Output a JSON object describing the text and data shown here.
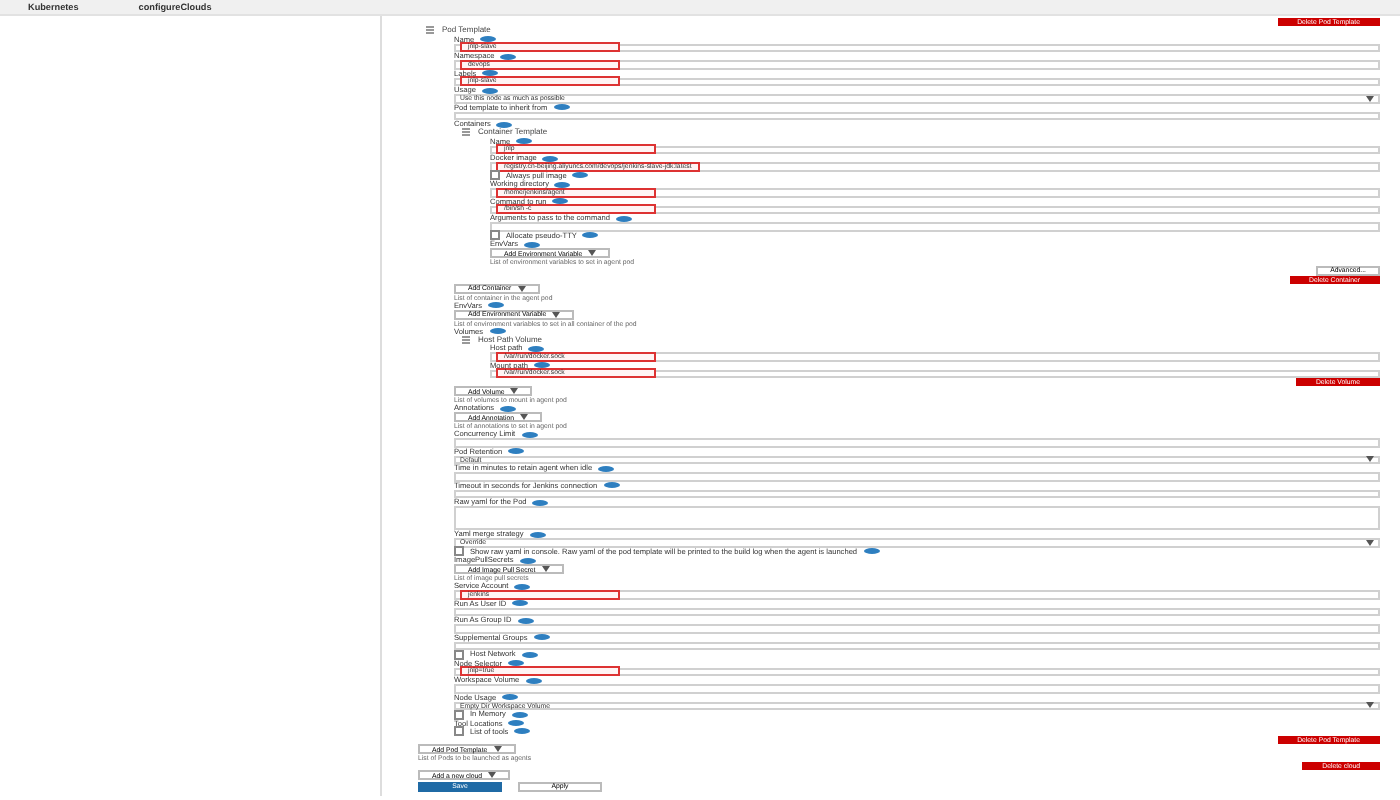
{
  "topbar": {
    "brand": "Kubernetes",
    "crumb": "configureClouds"
  },
  "items": [
    {
      "kind": "delete",
      "label": "Delete Pod Template"
    },
    {
      "kind": "section",
      "title": "Pod Template",
      "children": [
        {
          "kind": "field",
          "label": "Name",
          "value": "jnlp-slave",
          "highlighted": true
        },
        {
          "kind": "field",
          "label": "Namespace",
          "value": "devops",
          "highlighted": true
        },
        {
          "kind": "field",
          "label": "Labels",
          "value": "jnlp-slave",
          "highlighted": true
        },
        {
          "kind": "select",
          "label": "Usage",
          "value": "Use this node as much as possible",
          "highlighted": false
        },
        {
          "kind": "field",
          "label": "Pod template to inherit from",
          "highlighted": false
        },
        {
          "kind": "label",
          "label": "Containers"
        },
        {
          "kind": "section",
          "title": "Container Template",
          "children": [
            {
              "kind": "field",
              "label": "Name",
              "value": "jnlp",
              "highlighted": true
            },
            {
              "kind": "field",
              "label": "Docker image",
              "value": "registry.cn-beijing.aliyuncs.com/devops/jenkins-slave-jdk:latest",
              "highlighted": true
            },
            {
              "kind": "checkbox",
              "label": "Always pull image",
              "checked": false
            },
            {
              "kind": "field",
              "label": "Working directory",
              "value": "/home/jenkins/agent",
              "highlighted": true
            },
            {
              "kind": "field",
              "label": "Command to run",
              "value": "/bin/sh -c",
              "highlighted": true
            },
            {
              "kind": "field",
              "label": "Arguments to pass to the command",
              "highlighted": false
            },
            {
              "kind": "checkbox",
              "label": "Allocate pseudo-TTY",
              "checked": false
            },
            {
              "kind": "label",
              "label": "EnvVars"
            },
            {
              "kind": "dropdown",
              "label": "Add Environment Variable"
            },
            {
              "kind": "note",
              "text": "List of environment variables to set in agent pod"
            },
            {
              "kind": "advanced",
              "label": "Advanced..."
            },
            {
              "kind": "delete",
              "label": "Delete Container"
            }
          ]
        },
        {
          "kind": "dropdown",
          "label": "Add Container"
        },
        {
          "kind": "note",
          "text": "List of container in the agent pod"
        },
        {
          "kind": "label",
          "label": "EnvVars"
        },
        {
          "kind": "dropdown",
          "label": "Add Environment Variable"
        },
        {
          "kind": "note",
          "text": "List of environment variables to set in all container of the pod"
        },
        {
          "kind": "label",
          "label": "Volumes"
        },
        {
          "kind": "section",
          "title": "Host Path Volume",
          "children": [
            {
              "kind": "field",
              "label": "Host path",
              "value": "/var/run/docker.sock",
              "highlighted": true
            },
            {
              "kind": "field",
              "label": "Mount path",
              "value": "/var/run/docker.sock",
              "highlighted": true
            },
            {
              "kind": "delete",
              "label": "Delete Volume"
            }
          ]
        },
        {
          "kind": "dropdown",
          "label": "Add Volume"
        },
        {
          "kind": "note",
          "text": "List of volumes to mount in agent pod"
        },
        {
          "kind": "label",
          "label": "Annotations"
        },
        {
          "kind": "dropdown",
          "label": "Add Annotation"
        },
        {
          "kind": "note",
          "text": "List of annotations to set in agent pod"
        },
        {
          "kind": "field",
          "label": "Concurrency Limit",
          "highlighted": false
        },
        {
          "kind": "select",
          "label": "Pod Retention",
          "value": "Default",
          "highlighted": false
        },
        {
          "kind": "field",
          "label": "Time in minutes to retain agent when idle",
          "highlighted": false
        },
        {
          "kind": "field",
          "label": "Timeout in seconds for Jenkins connection",
          "highlighted": false
        },
        {
          "kind": "textarea",
          "label": "Raw yaml for the Pod"
        },
        {
          "kind": "select",
          "label": "Yaml merge strategy",
          "value": "Override",
          "highlighted": false
        },
        {
          "kind": "checkbox",
          "label": "Show raw yaml in console. Raw yaml of the pod template will be printed to the build log when the agent is launched",
          "checked": false
        },
        {
          "kind": "label",
          "label": "ImagePullSecrets"
        },
        {
          "kind": "dropdown",
          "label": "Add Image Pull Secret"
        },
        {
          "kind": "note",
          "text": "List of image pull secrets"
        },
        {
          "kind": "field",
          "label": "Service Account",
          "value": "jenkins",
          "highlighted": true
        },
        {
          "kind": "field",
          "label": "Run As User ID",
          "highlighted": false
        },
        {
          "kind": "field",
          "label": "Run As Group ID",
          "highlighted": false
        },
        {
          "kind": "field",
          "label": "Supplemental Groups",
          "highlighted": false
        },
        {
          "kind": "checkbox",
          "label": "Host Network",
          "checked": false
        },
        {
          "kind": "field",
          "label": "Node Selector",
          "value": "jnlp=true",
          "highlighted": true
        },
        {
          "kind": "field",
          "label": "Workspace Volume",
          "highlighted": false
        },
        {
          "kind": "select",
          "label": "Node Usage",
          "value": "Empty Dir Workspace Volume",
          "highlighted": false
        },
        {
          "kind": "checkbox",
          "label": "In Memory",
          "checked": false
        },
        {
          "kind": "label",
          "label": "Tool Locations"
        },
        {
          "kind": "checkbox",
          "label": "List of tools",
          "checked": false
        },
        {
          "kind": "delete",
          "label": "Delete Pod Template"
        }
      ]
    },
    {
      "kind": "dropdown",
      "label": "Add Pod Template"
    },
    {
      "kind": "note",
      "text": "List of Pods to be launched as agents"
    },
    {
      "kind": "delete",
      "label": "Delete cloud"
    },
    {
      "kind": "dropdown",
      "label": "Add a new cloud"
    },
    {
      "kind": "actions",
      "buttons": [
        {
          "label": "Save",
          "primary": true
        },
        {
          "label": "Apply",
          "primary": false
        }
      ]
    }
  ]
}
